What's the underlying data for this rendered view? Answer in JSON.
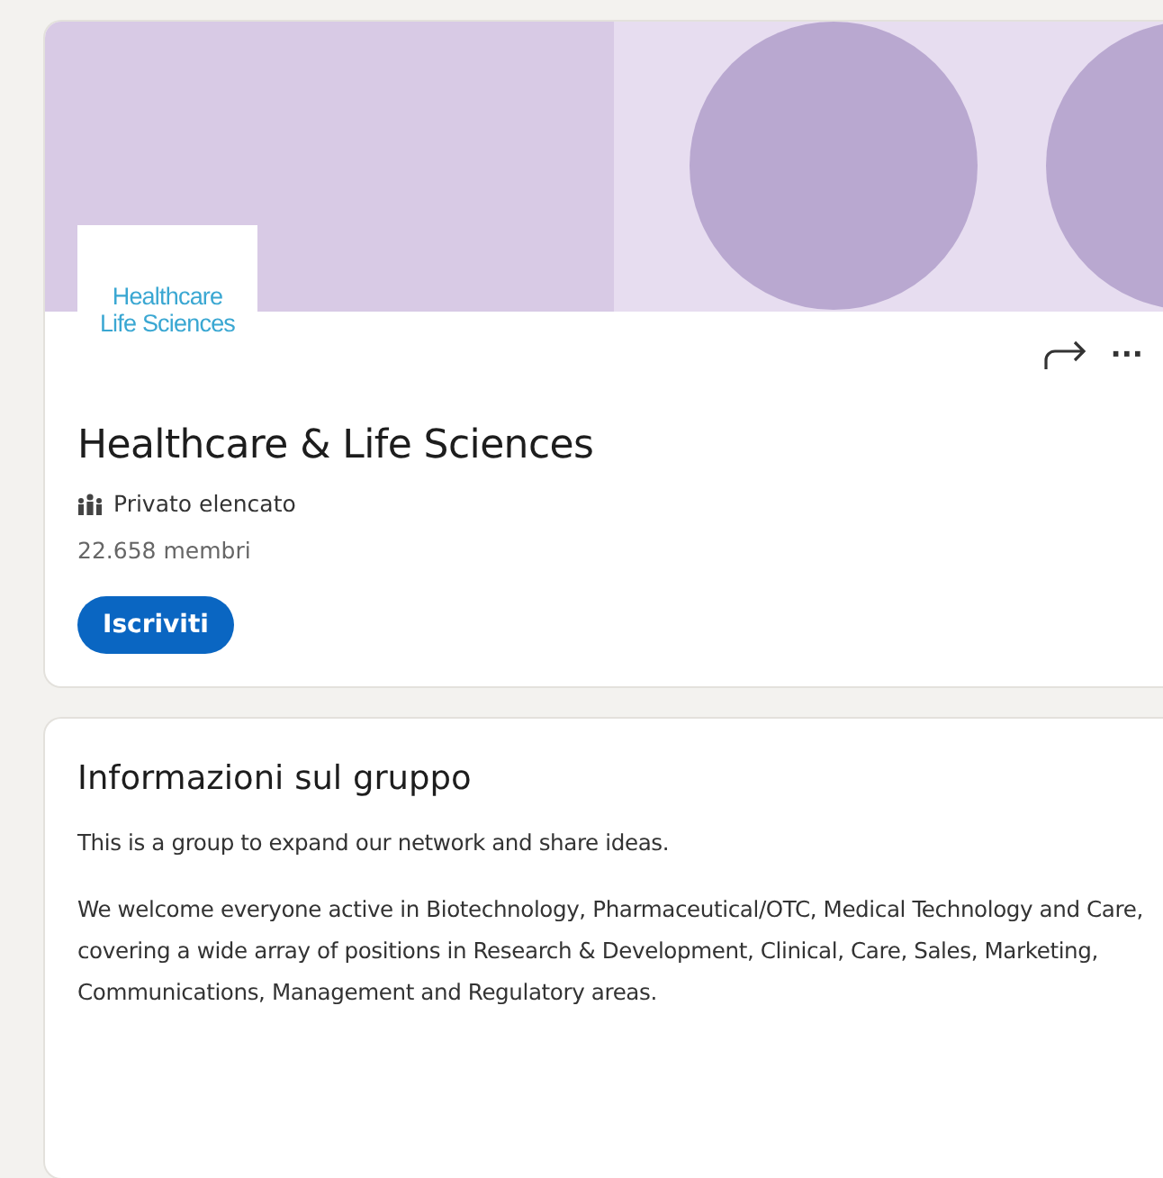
{
  "group": {
    "logo_lines": [
      "Healthcare",
      "Life Sciences"
    ],
    "title": "Healthcare & Life Sciences",
    "privacy": "Privato elencato",
    "members": "22.658 membri",
    "join_button": "Iscriviti",
    "actions": [
      {
        "kind": "share"
      },
      {
        "kind": "more",
        "label": "···"
      }
    ]
  },
  "about": {
    "title": "Informazioni sul gruppo",
    "paragraphs": [
      "This is a group to expand our network and share ideas.",
      "We welcome everyone active in Biotechnology, Pharmaceutical/OTC, Medical Technology and Care, covering a wide array of positions in Research & Development, Clinical, Care, Sales, Marketing, Communications, Management and Regulatory areas."
    ]
  }
}
